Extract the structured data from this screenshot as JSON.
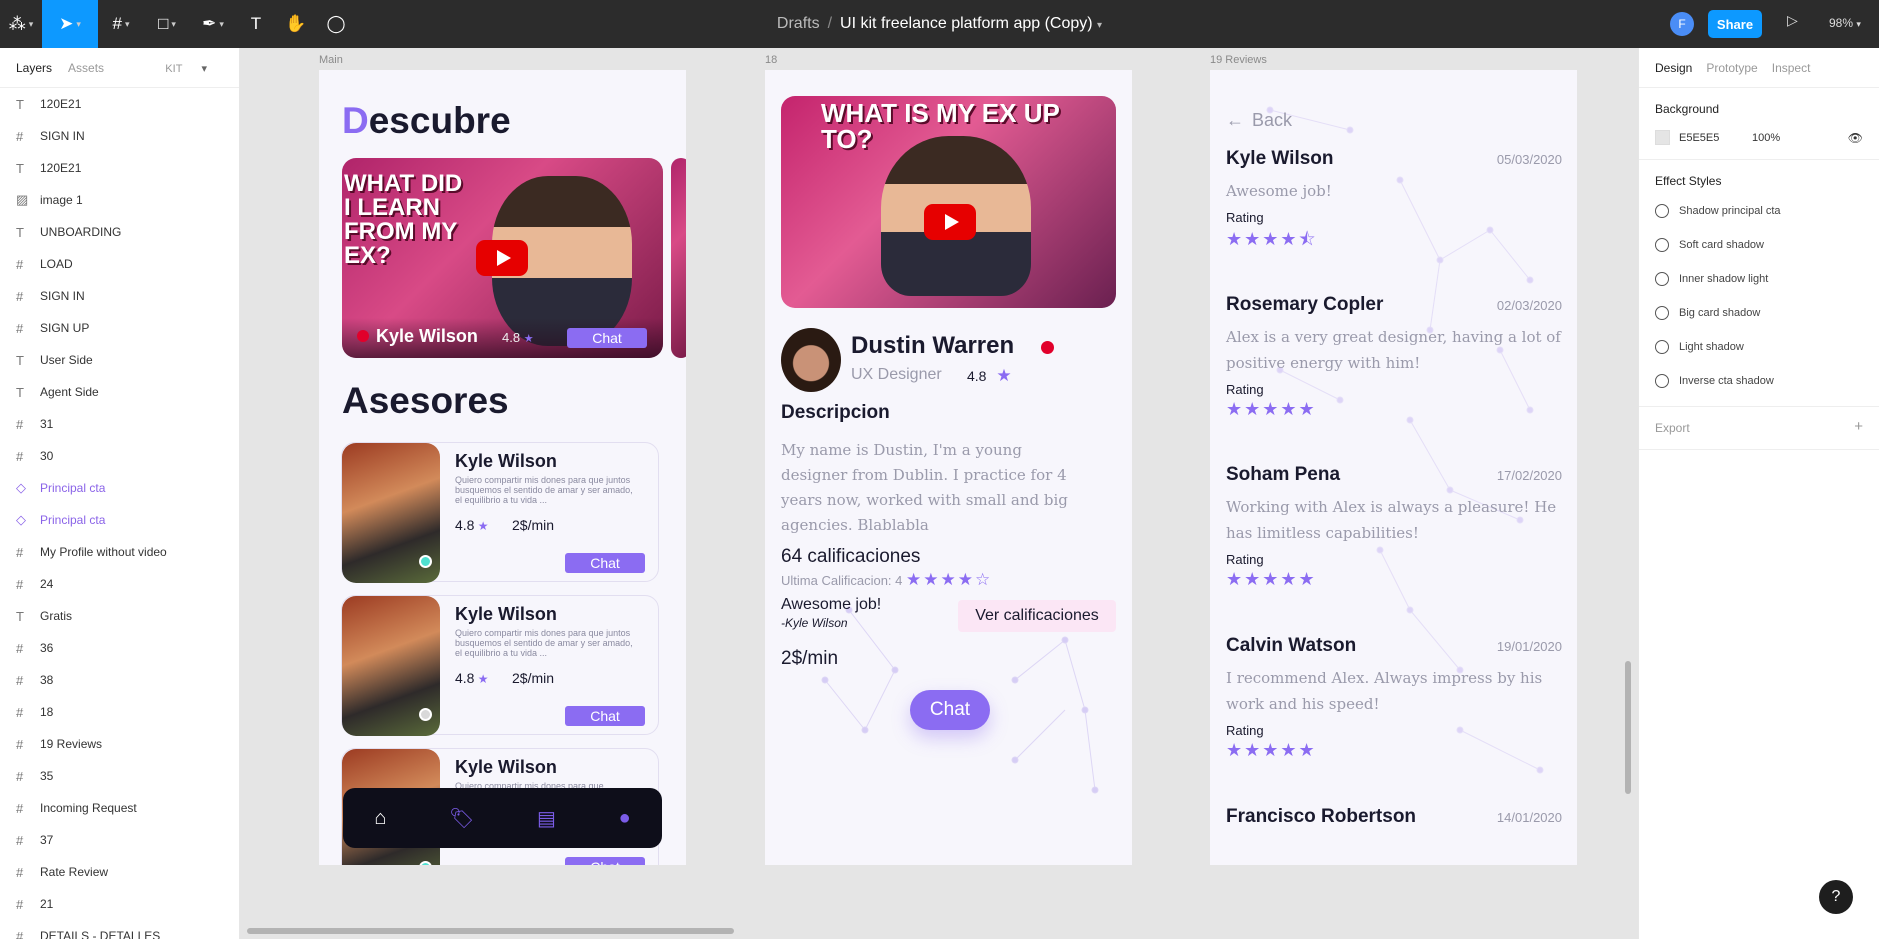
{
  "topbar": {
    "breadcrumb_parent": "Drafts",
    "breadcrumb_sep": "/",
    "file_name": "UI kit freelance platform app (Copy)",
    "avatar_initial": "F",
    "share_label": "Share",
    "zoom": "98%"
  },
  "layers_panel": {
    "tab_layers": "Layers",
    "tab_assets": "Assets",
    "kit_label": "KIT",
    "items": [
      {
        "icon": "T",
        "label": "120E21",
        "kind": "text"
      },
      {
        "icon": "#",
        "label": "SIGN IN",
        "kind": "frame"
      },
      {
        "icon": "T",
        "label": "120E21",
        "kind": "text"
      },
      {
        "icon": "▨",
        "label": "image 1",
        "kind": "image"
      },
      {
        "icon": "T",
        "label": "UNBOARDING",
        "kind": "text"
      },
      {
        "icon": "#",
        "label": "LOAD",
        "kind": "frame"
      },
      {
        "icon": "#",
        "label": "SIGN IN",
        "kind": "frame"
      },
      {
        "icon": "#",
        "label": "SIGN UP",
        "kind": "frame"
      },
      {
        "icon": "T",
        "label": "User Side",
        "kind": "text"
      },
      {
        "icon": "T",
        "label": "Agent Side",
        "kind": "text"
      },
      {
        "icon": "#",
        "label": "31",
        "kind": "frame"
      },
      {
        "icon": "#",
        "label": "30",
        "kind": "frame"
      },
      {
        "icon": "◇",
        "label": "Principal cta",
        "kind": "component"
      },
      {
        "icon": "◇",
        "label": "Principal cta",
        "kind": "component"
      },
      {
        "icon": "#",
        "label": "My Profile without video",
        "kind": "frame"
      },
      {
        "icon": "#",
        "label": "24",
        "kind": "frame"
      },
      {
        "icon": "T",
        "label": "Gratis",
        "kind": "text"
      },
      {
        "icon": "#",
        "label": "36",
        "kind": "frame"
      },
      {
        "icon": "#",
        "label": "38",
        "kind": "frame"
      },
      {
        "icon": "#",
        "label": "18",
        "kind": "frame"
      },
      {
        "icon": "#",
        "label": "19 Reviews",
        "kind": "frame"
      },
      {
        "icon": "#",
        "label": "35",
        "kind": "frame"
      },
      {
        "icon": "#",
        "label": "Incoming Request",
        "kind": "frame"
      },
      {
        "icon": "#",
        "label": "37",
        "kind": "frame"
      },
      {
        "icon": "#",
        "label": "Rate Review",
        "kind": "frame"
      },
      {
        "icon": "#",
        "label": "21",
        "kind": "frame"
      },
      {
        "icon": "#",
        "label": "DETAILS - DETALLES",
        "kind": "frame"
      }
    ]
  },
  "frames": {
    "main": {
      "label": "Main",
      "title_first_letter": "D",
      "title_rest": "escubre",
      "video_text": "WHAT DID I LEARN FROM MY EX?",
      "video_overlay_name": "Kyle Wilson",
      "video_overlay_rating": "4.8",
      "video_overlay_chat": "Chat",
      "asesores_title": "Asesores",
      "cards": [
        {
          "name": "Kyle Wilson",
          "desc": "Quiero compartir mis dones para que juntos busquemos el sentido de amar y ser amado, el equilibrio a tu vida ...",
          "rating": "4.8",
          "price": "2$/min",
          "chat": "Chat",
          "status": "online"
        },
        {
          "name": "Kyle Wilson",
          "desc": "Quiero compartir mis dones para que juntos busquemos el sentido de amar y ser amado, el equilibrio a tu vida ...",
          "rating": "4.8",
          "price": "2$/min",
          "chat": "Chat",
          "status": "offline"
        },
        {
          "name": "Kyle Wilson",
          "desc": "Quiero compartir mis dones para que",
          "rating": "",
          "price": "",
          "chat": "Chat",
          "status": "online"
        }
      ]
    },
    "profile": {
      "label": "18",
      "video_text": "WHAT IS MY EX UP TO?",
      "name": "Dustin Warren",
      "role": "UX Designer",
      "rating": "4.8",
      "desc_title": "Descripcion",
      "desc": "My name is Dustin, I'm a young designer from Dublin. I practice for 4 years now, worked with small and big agencies. Blablabla",
      "ratings_count": "64 calificaciones",
      "last_rating_label": "Ultima Calificacion:",
      "last_rating_value": "4",
      "last_comment": "Awesome job!",
      "last_author": "-Kyle Wilson",
      "see_ratings": "Ver calificaciones",
      "price": "2$/min",
      "chat": "Chat"
    },
    "reviews": {
      "label": "19 Reviews",
      "back": "Back",
      "rating_label": "Rating",
      "items": [
        {
          "name": "Kyle Wilson",
          "date": "05/03/2020",
          "text": "Awesome job!",
          "stars": 4.5
        },
        {
          "name": "Rosemary Copler",
          "date": "02/03/2020",
          "text": "Alex is a very great designer, having a lot of positive energy with him!",
          "stars": 5
        },
        {
          "name": "Soham Pena",
          "date": "17/02/2020",
          "text": "Working with Alex is always a pleasure! He has limitless capabilities!",
          "stars": 5
        },
        {
          "name": "Calvin Watson",
          "date": "19/01/2020",
          "text": "I recommend Alex. Always impress by his work and his speed!",
          "stars": 5
        },
        {
          "name": "Francisco Robertson",
          "date": "14/01/2020",
          "text": "",
          "stars": 0
        }
      ]
    }
  },
  "design_panel": {
    "tab_design": "Design",
    "tab_prototype": "Prototype",
    "tab_inspect": "Inspect",
    "background_title": "Background",
    "bg_hex": "E5E5E5",
    "bg_opacity": "100%",
    "effect_styles_title": "Effect Styles",
    "effects": [
      "Shadow principal cta",
      "Soft card shadow",
      "Inner shadow light",
      "Big card shadow",
      "Light shadow",
      "Inverse cta shadow"
    ],
    "export_title": "Export"
  },
  "help": "?",
  "colors": {
    "accent": "#8b6cf2",
    "figma_blue": "#0d99ff",
    "toolbar": "#2c2c2c",
    "canvas": "#e5e5e5"
  }
}
